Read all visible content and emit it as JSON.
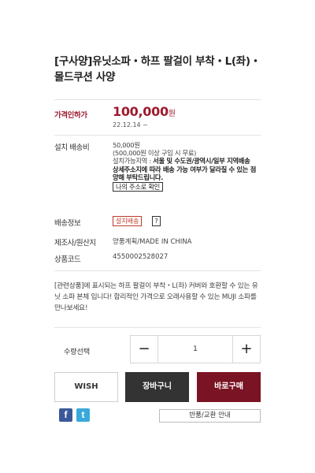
{
  "product": {
    "title": "[구사양]유닛소파・하프 팔걸이 부착・L(좌)・몰드쿠션 사양"
  },
  "price": {
    "label": "가격인하가",
    "value": "100,000",
    "unit": "원",
    "date": "22.12.14 ~"
  },
  "shipping": {
    "label": "설치 배송비",
    "fee": "50,000원",
    "condition": "(500,000원 이상 구입 시 무료)",
    "area_prefix": "설치가능지역 : ",
    "area_bold": "서울 및 수도권/광역시/일부 지역배송",
    "notice": "상세주소지에 따라 배송 가능 여부가 달라질 수 있는 점 양해 부탁드립니다.",
    "address_button": "나의 주소로 확인"
  },
  "delivery_info": {
    "label": "배송정보",
    "tag": "설치배송",
    "help": "?"
  },
  "maker": {
    "label": "제조사/원산지",
    "value": "양품계획/MADE IN CHINA"
  },
  "code": {
    "label": "상품코드",
    "value": "4550002528027"
  },
  "description": "[관련상품]에 표시되는 하프 팔걸이 부착・L(좌) 커버와 호환할 수 있는 유닛 소파 본체 입니다! 합리적인 가격으로 오래사용할 수 있는 MUJI 소파를 만나보세요!",
  "quantity": {
    "label": "수량선택",
    "minus": "−",
    "value": "1",
    "plus": "+"
  },
  "actions": {
    "wish": "WISH",
    "cart": "장바구니",
    "buy": "바로구매"
  },
  "social": {
    "facebook": "f",
    "twitter": "t"
  },
  "policy_button": "반품/교환 안내",
  "colors": {
    "accent": "#9e1a2e",
    "buy_button": "#7a1323",
    "cart_button": "#333333",
    "facebook": "#3b5998",
    "twitter": "#3aa8db"
  }
}
